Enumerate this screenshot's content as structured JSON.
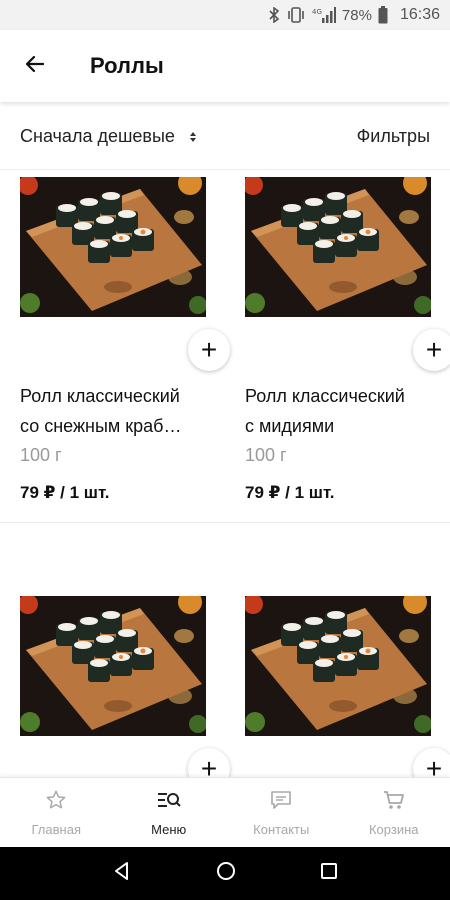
{
  "status_bar": {
    "icons": [
      "bluetooth-icon",
      "vibrate-icon",
      "signal-4g-icon"
    ],
    "network_label": "4G",
    "battery_text": "78%",
    "time": "16:36"
  },
  "header": {
    "back_icon": "arrow-left-icon",
    "title": "Роллы"
  },
  "toolbar": {
    "sort_label": "Сначала дешевые",
    "filters_label": "Фильтры"
  },
  "products": [
    {
      "name_line1": "Ролл классический",
      "name_line2": "со снежным краб…",
      "weight": "100 г",
      "price": "79 ₽ / 1 шт.",
      "add_label": "+"
    },
    {
      "name_line1": "Ролл классический",
      "name_line2": "с мидиями",
      "weight": "100 г",
      "price": "79 ₽ / 1 шт.",
      "add_label": "+"
    },
    {
      "add_label": "+"
    },
    {
      "add_label": "+"
    }
  ],
  "bottom_nav": {
    "items": [
      {
        "label": "Главная",
        "icon": "star-icon",
        "active": false
      },
      {
        "label": "Меню",
        "icon": "menu-search-icon",
        "active": true
      },
      {
        "label": "Контакты",
        "icon": "chat-icon",
        "active": false
      },
      {
        "label": "Корзина",
        "icon": "cart-icon",
        "active": false
      }
    ]
  },
  "colors": {
    "accent_text": "#222222",
    "muted_text": "#a8a8a8",
    "board_wood": "#b9773f",
    "roll_nori": "#1e2a22"
  }
}
